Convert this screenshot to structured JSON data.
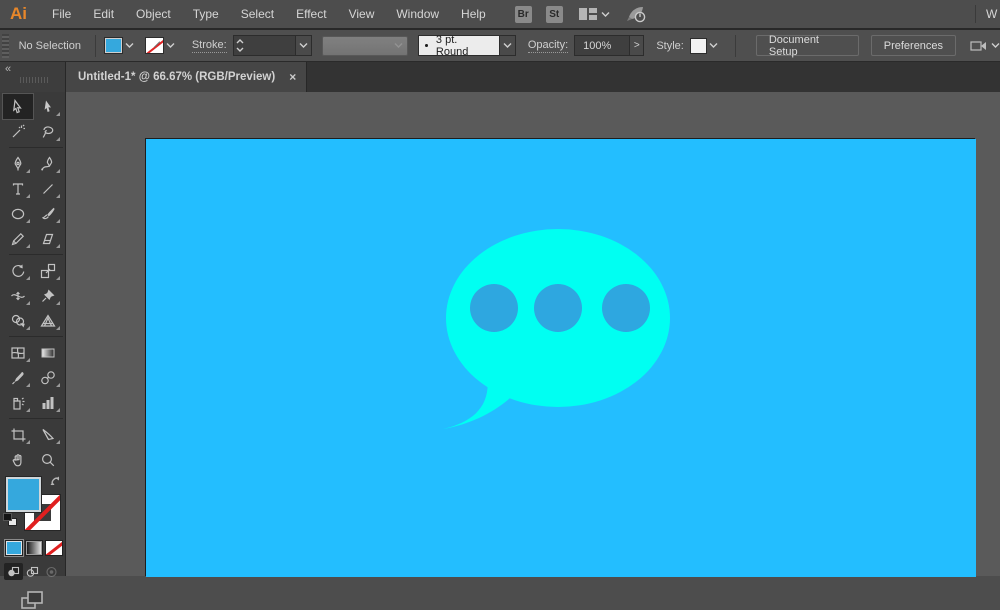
{
  "colors": {
    "canvas_blue": "#23beff",
    "bubble_cyan": "#00fff2",
    "dot_blue": "#2ea7e0",
    "fill_swatch_blue": "#35a8dd",
    "chrome_gray": "#4d4d4d",
    "logo_orange": "#e8872a"
  },
  "menubar": {
    "logo": "Ai",
    "items": [
      "File",
      "Edit",
      "Object",
      "Type",
      "Select",
      "Effect",
      "View",
      "Window",
      "Help"
    ],
    "bridge_button": "Br",
    "stock_button": "St",
    "workspace_partial": "W"
  },
  "controlbar": {
    "selection_status": "No Selection",
    "stroke_label": "Stroke:",
    "brush_value": "3 pt. Round",
    "opacity_label": "Opacity:",
    "opacity_value": "100%",
    "opacity_arrow": ">",
    "style_label": "Style:",
    "document_setup": "Document Setup",
    "preferences": "Preferences"
  },
  "tabbar": {
    "collapse_icon": "«",
    "document_title": "Untitled-1* @ 66.67% (RGB/Preview)",
    "close_icon": "×"
  },
  "tools": {
    "rows": [
      [
        "selection",
        "direct-selection"
      ],
      [
        "magic-wand",
        "lasso"
      ],
      [
        "pen",
        "curvature"
      ],
      [
        "type",
        "line-segment"
      ],
      [
        "ellipse",
        "paintbrush"
      ],
      [
        "shaper",
        "eraser"
      ],
      [
        "rotate",
        "scale"
      ],
      [
        "width",
        "puppet-warp"
      ],
      [
        "shape-builder",
        "perspective-grid"
      ],
      [
        "mesh",
        "gradient"
      ],
      [
        "eyedropper",
        "blend"
      ],
      [
        "symbol-sprayer",
        "column-graph"
      ],
      [
        "artboard",
        "slice"
      ],
      [
        "hand",
        "zoom"
      ]
    ],
    "active_tool": "selection"
  },
  "canvas": {
    "artboard_label": "speech-bubble-artwork",
    "dot_count": 3
  }
}
